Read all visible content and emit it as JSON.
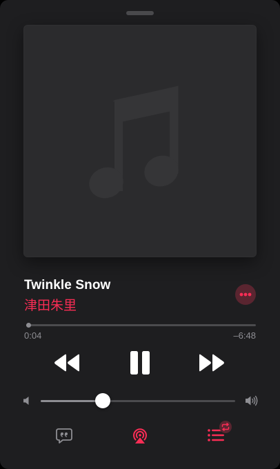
{
  "now_playing": {
    "title": "Twinkle Snow",
    "artist": "津田朱里",
    "artwork_icon": "music-note-icon"
  },
  "progress": {
    "elapsed": "0:04",
    "remaining": "–6:48",
    "fraction": 0.01
  },
  "controls": {
    "rewind_icon": "rewind-icon",
    "pause_icon": "pause-icon",
    "forward_icon": "fast-forward-icon"
  },
  "volume": {
    "fraction": 0.32,
    "low_icon": "speaker-low-icon",
    "high_icon": "speaker-high-icon"
  },
  "bottom_bar": {
    "lyrics_icon": "lyrics-icon",
    "airplay_icon": "airplay-icon",
    "queue_icon": "queue-icon",
    "queue_badge_icon": "repeat-icon"
  },
  "colors": {
    "accent": "#fa2d55",
    "background": "#1e1e20",
    "text_primary": "#ffffff",
    "text_secondary": "#8e8e93"
  }
}
